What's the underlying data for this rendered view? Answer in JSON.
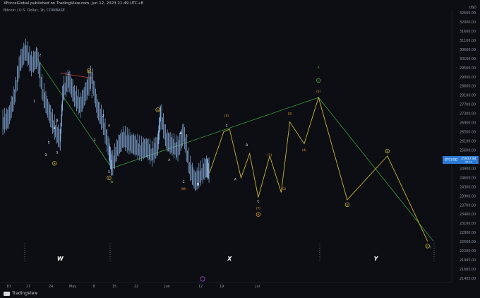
{
  "header": {
    "publisher": "XForceGlobal published on TradingView.com, Jun 12, 2023 21:49 UTC+8",
    "symbol": "Bitcoin / U.S. Dollar, 1h, COINBASE",
    "currency": "USD",
    "logo_text": "TradingView"
  },
  "colors": {
    "background": "#0c0e13",
    "candles": "#8fb6e8",
    "wave_lines_green": "#3f9a3a",
    "projection_yellow": "#c9b43a",
    "label_orange": "#f0a030",
    "label_white": "#ffffff",
    "price_tag_bg": "#2b7bd6",
    "rsi_purple": "#b04fd6"
  },
  "price_tag": {
    "label": "BTCUSD",
    "value": "25937.84",
    "sub": "00:10"
  },
  "chart_data": {
    "type": "line",
    "y_axis_labels": [
      "32600.00",
      "32000.00",
      "31600.00",
      "31100.00",
      "30600.00",
      "30100.00",
      "29500.00",
      "29000.00",
      "28600.00",
      "28100.00",
      "27700.00",
      "27300.00",
      "26900.00",
      "26500.00",
      "26100.00",
      "25600.00",
      "25200.00",
      "24900.00",
      "24600.00",
      "24300.00",
      "23900.00",
      "23700.00",
      "23400.00",
      "23100.00",
      "22800.00",
      "22500.00",
      "22200.00",
      "21945.00",
      "21685.00",
      "21405.00"
    ],
    "x_axis_labels": [
      "10",
      "17",
      "24",
      "May",
      "8",
      "15",
      "22",
      "Jun",
      "12",
      "19",
      "Jul"
    ],
    "ylim": [
      21405,
      32600
    ],
    "price_history": [
      {
        "x": 0,
        "y": 27900
      },
      {
        "x": 2,
        "y": 28100
      },
      {
        "x": 4,
        "y": 29000
      },
      {
        "x": 6,
        "y": 30400
      },
      {
        "x": 8,
        "y": 30900
      },
      {
        "x": 10,
        "y": 30300
      },
      {
        "x": 12,
        "y": 30600
      },
      {
        "x": 14,
        "y": 29100
      },
      {
        "x": 16,
        "y": 28400
      },
      {
        "x": 18,
        "y": 27700
      },
      {
        "x": 20,
        "y": 27200
      },
      {
        "x": 21,
        "y": 29200
      },
      {
        "x": 23,
        "y": 29700
      },
      {
        "x": 25,
        "y": 29000
      },
      {
        "x": 27,
        "y": 28600
      },
      {
        "x": 29,
        "y": 29200
      },
      {
        "x": 31,
        "y": 29800
      },
      {
        "x": 33,
        "y": 28500
      },
      {
        "x": 35,
        "y": 27900
      },
      {
        "x": 37,
        "y": 26800
      },
      {
        "x": 38,
        "y": 26100
      },
      {
        "x": 40,
        "y": 26900
      },
      {
        "x": 42,
        "y": 27300
      },
      {
        "x": 44,
        "y": 27100
      },
      {
        "x": 46,
        "y": 27000
      },
      {
        "x": 48,
        "y": 26800
      },
      {
        "x": 50,
        "y": 26900
      },
      {
        "x": 52,
        "y": 26600
      },
      {
        "x": 54,
        "y": 27000
      },
      {
        "x": 55,
        "y": 28300
      },
      {
        "x": 57,
        "y": 27200
      },
      {
        "x": 59,
        "y": 27000
      },
      {
        "x": 61,
        "y": 26800
      },
      {
        "x": 63,
        "y": 27500
      },
      {
        "x": 65,
        "y": 26100
      },
      {
        "x": 67,
        "y": 25500
      },
      {
        "x": 69,
        "y": 25800
      },
      {
        "x": 71,
        "y": 26100
      },
      {
        "x": 72,
        "y": 25900
      }
    ],
    "wave_green": [
      {
        "x": 12,
        "y": 30600
      },
      {
        "x": 38,
        "y": 26100
      },
      {
        "x": 110,
        "y": 29000
      },
      {
        "x": 150,
        "y": 23100
      }
    ],
    "wave_projection_yellow": [
      {
        "x": 72,
        "y": 25900
      },
      {
        "x": 77,
        "y": 27600
      },
      {
        "x": 79,
        "y": 27700
      },
      {
        "x": 83,
        "y": 25700
      },
      {
        "x": 86,
        "y": 26700
      },
      {
        "x": 89,
        "y": 24900
      },
      {
        "x": 93,
        "y": 26600
      },
      {
        "x": 97,
        "y": 25100
      },
      {
        "x": 100,
        "y": 28000
      },
      {
        "x": 105,
        "y": 27100
      },
      {
        "x": 110,
        "y": 29000
      },
      {
        "x": 120,
        "y": 24800
      },
      {
        "x": 134,
        "y": 26600
      },
      {
        "x": 148,
        "y": 23100
      }
    ],
    "red_line": [
      {
        "x": 20,
        "y": 30000
      },
      {
        "x": 31,
        "y": 29800
      }
    ],
    "wave_labels": [
      {
        "text": "W",
        "x": 20,
        "y": 22300,
        "color": "white"
      },
      {
        "text": "X",
        "x": 79,
        "y": 22300,
        "color": "white"
      },
      {
        "text": "Y",
        "x": 130,
        "y": 22300,
        "color": "white"
      }
    ],
    "circled_labels": [
      {
        "text": "A",
        "x": 18,
        "y": 26300,
        "color": "yellow"
      },
      {
        "text": "B",
        "x": 30,
        "y": 30100,
        "color": "yellow"
      },
      {
        "text": "C",
        "x": 37,
        "y": 25700,
        "color": "yellow"
      },
      {
        "text": "A",
        "x": 54,
        "y": 28500,
        "color": "yellow"
      },
      {
        "text": "C",
        "x": 110,
        "y": 29700,
        "color": "green"
      },
      {
        "text": "A",
        "x": 120,
        "y": 24600,
        "color": "yellow"
      },
      {
        "text": "B",
        "x": 134,
        "y": 26800,
        "color": "yellow"
      },
      {
        "text": "C",
        "x": 148,
        "y": 22900,
        "color": "yellow"
      },
      {
        "text": "B",
        "x": 89,
        "y": 24200,
        "color": "orange"
      }
    ],
    "small_labels": [
      {
        "text": "2",
        "x": 13,
        "y": 30700,
        "color": "white"
      },
      {
        "text": "1",
        "x": 11,
        "y": 28800,
        "color": "white"
      },
      {
        "text": "3",
        "x": 19,
        "y": 28000,
        "color": "white"
      },
      {
        "text": "4",
        "x": 18,
        "y": 27700,
        "color": "white"
      },
      {
        "text": "5",
        "x": 16,
        "y": 27100,
        "color": "white"
      },
      {
        "text": "3",
        "x": 15,
        "y": 26600,
        "color": "white"
      },
      {
        "text": "5",
        "x": 19,
        "y": 26700,
        "color": "white"
      },
      {
        "text": "1",
        "x": 31,
        "y": 29000,
        "color": "white"
      },
      {
        "text": "2",
        "x": 35,
        "y": 28200,
        "color": "white"
      },
      {
        "text": "3",
        "x": 32,
        "y": 27200,
        "color": "white"
      },
      {
        "text": "4",
        "x": 37,
        "y": 27800,
        "color": "white"
      },
      {
        "text": "5",
        "x": 37,
        "y": 25900,
        "color": "white"
      },
      {
        "text": "B",
        "x": 62,
        "y": 27500,
        "color": "white"
      },
      {
        "text": "A",
        "x": 64,
        "y": 27400,
        "color": "white"
      },
      {
        "text": "A",
        "x": 58,
        "y": 26400,
        "color": "white"
      },
      {
        "text": "C",
        "x": 63,
        "y": 25500,
        "color": "white"
      },
      {
        "text": "B",
        "x": 68,
        "y": 25400,
        "color": "white"
      },
      {
        "text": "C",
        "x": 78,
        "y": 27800,
        "color": "white"
      },
      {
        "text": "B",
        "x": 85,
        "y": 27000,
        "color": "white"
      },
      {
        "text": "A",
        "x": 81,
        "y": 25600,
        "color": "white"
      },
      {
        "text": "C",
        "x": 89,
        "y": 24700,
        "color": "white"
      },
      {
        "text": "(X)",
        "x": 78,
        "y": 28200,
        "color": "orange"
      },
      {
        "text": "(W)",
        "x": 63,
        "y": 25200,
        "color": "orange"
      },
      {
        "text": "(Y)",
        "x": 89,
        "y": 24400,
        "color": "orange"
      },
      {
        "text": "(1)",
        "x": 93,
        "y": 26600,
        "color": "orange"
      },
      {
        "text": "(2)",
        "x": 98,
        "y": 25200,
        "color": "orange"
      },
      {
        "text": "(3)",
        "x": 100,
        "y": 28300,
        "color": "orange"
      },
      {
        "text": "(4)",
        "x": 105,
        "y": 26800,
        "color": "orange"
      },
      {
        "text": "(5)",
        "x": 110,
        "y": 29200,
        "color": "orange"
      },
      {
        "text": "W",
        "x": 38,
        "y": 25500,
        "color": "green"
      },
      {
        "text": "X",
        "x": 110,
        "y": 30200,
        "color": "green"
      },
      {
        "text": "Y",
        "x": 149,
        "y": 22800,
        "color": "green"
      }
    ]
  }
}
